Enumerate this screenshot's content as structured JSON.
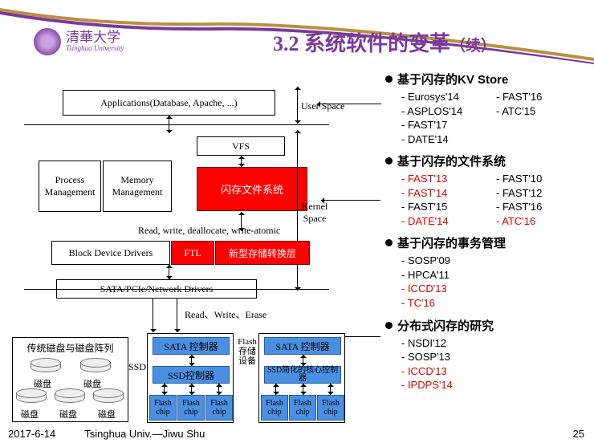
{
  "header": {
    "university_cn": "清華大学",
    "university_en": "Tsinghua University",
    "title_main": "3.2 系统软件的变革",
    "title_cont": "（续）"
  },
  "sections": [
    {
      "head": "基于闪存的KV Store",
      "cols": 2,
      "pubs": [
        {
          "t": "Eurosys'14"
        },
        {
          "t": "FAST'16"
        },
        {
          "t": "ASPLOS'14"
        },
        {
          "t": "ATC'15"
        },
        {
          "t": "FAST'17"
        },
        {
          "t": ""
        },
        {
          "t": "DATE'14"
        },
        {
          "t": ""
        }
      ]
    },
    {
      "head": "基于闪存的文件系统",
      "cols": 2,
      "pubs": [
        {
          "t": "FAST'13",
          "red": true
        },
        {
          "t": "FAST'10"
        },
        {
          "t": "FAST'14",
          "red": true
        },
        {
          "t": "FAST'12"
        },
        {
          "t": "FAST'15"
        },
        {
          "t": "FAST'16"
        },
        {
          "t": "DATE'14",
          "red": true
        },
        {
          "t": "ATC'16",
          "red": true
        }
      ]
    },
    {
      "head": "基于闪存的事务管理",
      "cols": 1,
      "pubs": [
        {
          "t": "SOSP'09"
        },
        {
          "t": "HPCA'11"
        },
        {
          "t": "ICCD'13",
          "red": true
        },
        {
          "t": "TC'16",
          "red": true
        }
      ]
    },
    {
      "head": "分布式闪存的研究",
      "cols": 1,
      "pubs": [
        {
          "t": "NSDI'12"
        },
        {
          "t": "SOSP'13"
        },
        {
          "t": "ICCD'13",
          "red": true
        },
        {
          "t": "IPDPS'14",
          "red": true
        }
      ]
    }
  ],
  "diagram": {
    "apps": "Applications(Database, Apache, ...)",
    "user_space": "User Space",
    "vfs": "VFS",
    "proc": "Process Management",
    "mem": "Memory Management",
    "flashfs": "闪存文件系统",
    "kernel_space": "Kernel Space",
    "rw_dealloc": "Read, write, deallocate, write-atomic",
    "bdd": "Block Device Drivers",
    "ftl": "FTL",
    "newlayer": "新型存储转换层",
    "sata_drv": "SATA/PCIe/Network Drivers",
    "rwe": "Read、Write、Erase",
    "trad_title": "传统磁盘与磁盘阵列",
    "disk": "磁盘",
    "ssd_lbl": "SSD",
    "sata_ctrl": "SATA 控制器",
    "ssd_ctrl": "SSD控制器",
    "flash_chip": "Flash chip",
    "flash_dev": "Flash 存储 设备",
    "ssd_simpl": "SSD简化的核心控制器"
  },
  "footer": {
    "date": "2017-6-14",
    "source": "Tsinghua Univ.—Jiwu Shu",
    "page": "25"
  }
}
